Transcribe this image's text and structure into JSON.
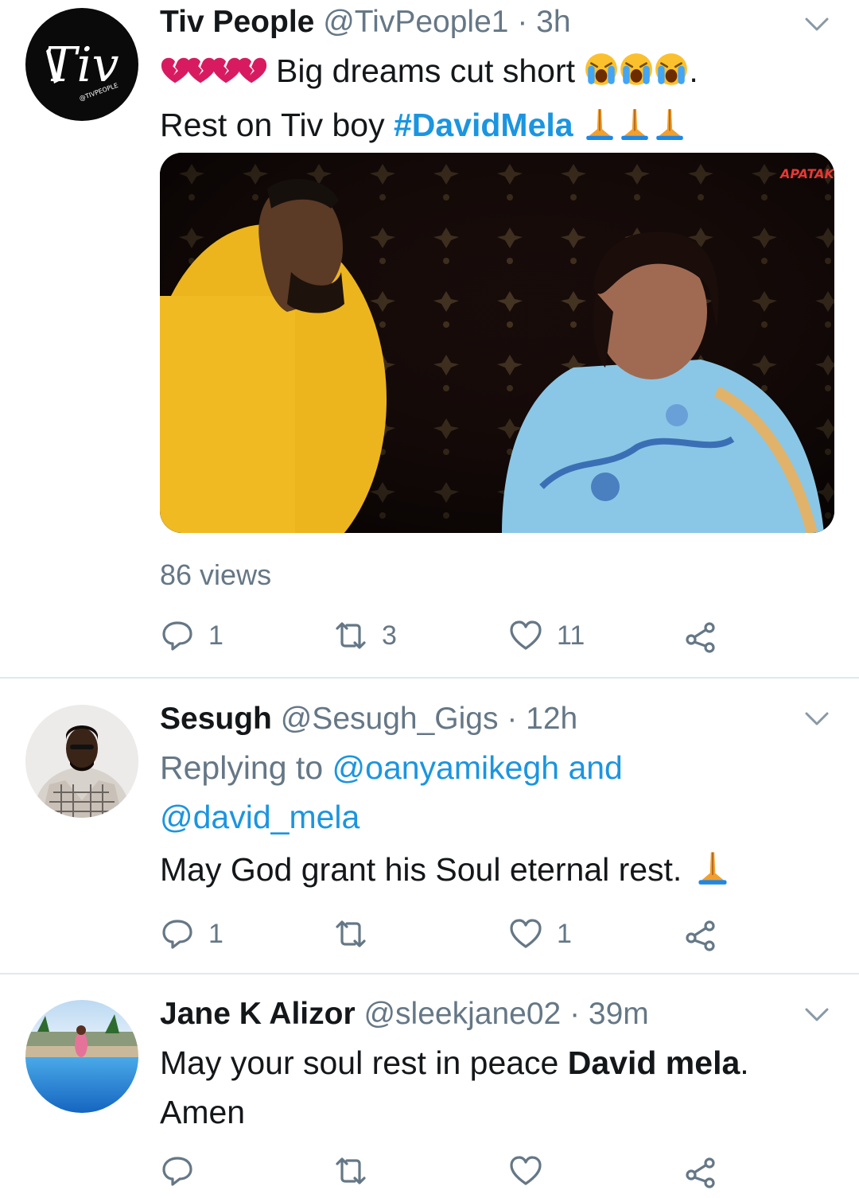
{
  "tweets": [
    {
      "name": "Tiv People",
      "handle": "@TivPeople1",
      "dot": "·",
      "time": "3h",
      "text1": "Big dreams cut short",
      "text1_end": ".",
      "text2": "Rest on Tiv boy",
      "hashtag": "#DavidMela",
      "views": "86 views",
      "reply_count": "1",
      "retweet_count": "3",
      "like_count": "11",
      "avatar_text": "Tiv",
      "avatar_subtext": "@TIVPEOPLE",
      "watermark": "APATAKO"
    },
    {
      "name": "Sesugh",
      "handle": "@Sesugh_Gigs",
      "dot": "·",
      "time": "12h",
      "replying_prefix": "Replying to",
      "replying_user1": "@oanyamikegh",
      "replying_and": "and",
      "replying_user2": "@david_mela",
      "text": "May God grant his Soul eternal rest.",
      "reply_count": "1",
      "retweet_count": "",
      "like_count": "1"
    },
    {
      "name": "Jane K Alizor",
      "handle": "@sleekjane02",
      "dot": "·",
      "time": "39m",
      "text_prefix": "May your soul rest in peace",
      "text_bold": "David mela",
      "text_end": ".",
      "text_line2": "Amen",
      "reply_count": "",
      "retweet_count": "",
      "like_count": ""
    }
  ],
  "colors": {
    "link": "#1b95e0",
    "muted": "#657786",
    "divider": "#e1e8ed",
    "text": "#14171a"
  },
  "icons": [
    "chevron-down-icon",
    "reply-icon",
    "retweet-icon",
    "like-icon",
    "share-icon",
    "broken-heart-emoji",
    "crying-face-emoji",
    "folded-hands-emoji"
  ]
}
